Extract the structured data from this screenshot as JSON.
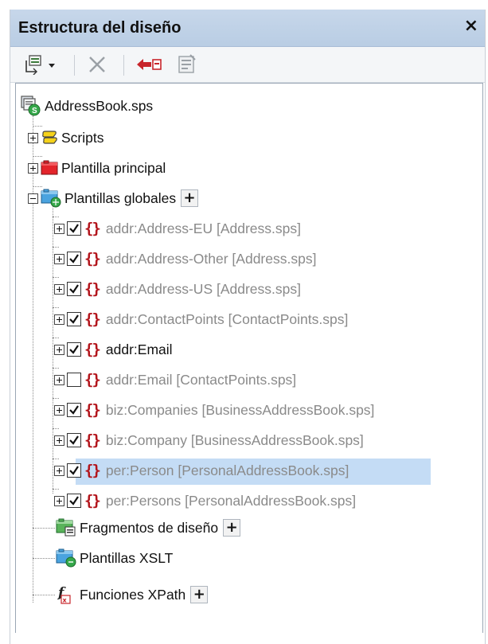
{
  "panel": {
    "title": "Estructura del diseño",
    "close_glyph": "×"
  },
  "toolbar": {
    "icons": [
      "add-node-icon",
      "remove-icon",
      "move-left-icon",
      "properties-icon"
    ]
  },
  "tree": {
    "root": {
      "label": "AddressBook.sps",
      "icon": "sps-file-icon"
    },
    "nodes": [
      {
        "label": "Scripts",
        "icon": "scripts-icon",
        "expanded": false
      },
      {
        "label": "Plantilla principal",
        "icon": "main-template-icon",
        "expanded": false
      },
      {
        "label": "Plantillas globales",
        "icon": "global-templates-icon",
        "expanded": true,
        "has_add_button": true,
        "add_label": "+"
      },
      {
        "label": "Fragmentos de diseño",
        "icon": "design-fragments-icon",
        "has_add_button": true,
        "add_label": "+"
      },
      {
        "label": "Plantillas XSLT",
        "icon": "xslt-templates-icon"
      },
      {
        "label": "Funciones XPath",
        "icon": "xpath-functions-icon",
        "has_add_button": true,
        "add_label": "+"
      }
    ],
    "global_templates": [
      {
        "label": "addr:Address-EU [Address.sps]",
        "checked": true,
        "imported": true
      },
      {
        "label": "addr:Address-Other [Address.sps]",
        "checked": true,
        "imported": true
      },
      {
        "label": "addr:Address-US [Address.sps]",
        "checked": true,
        "imported": true
      },
      {
        "label": "addr:ContactPoints [ContactPoints.sps]",
        "checked": true,
        "imported": true
      },
      {
        "label": "addr:Email",
        "checked": true,
        "imported": false
      },
      {
        "label": "addr:Email [ContactPoints.sps]",
        "checked": false,
        "imported": true
      },
      {
        "label": "biz:Companies [BusinessAddressBook.sps]",
        "checked": true,
        "imported": true
      },
      {
        "label": "biz:Company [BusinessAddressBook.sps]",
        "checked": true,
        "imported": true
      },
      {
        "label": "per:Person [PersonalAddressBook.sps]",
        "checked": true,
        "imported": true,
        "selected": true
      },
      {
        "label": "per:Persons [PersonalAddressBook.sps]",
        "checked": true,
        "imported": true
      }
    ]
  },
  "colors": {
    "titlebar": "#c7d7ea",
    "selection": "#c4dcf5",
    "template_brace": "#b3151c",
    "imported_text": "#8a8a8a"
  }
}
